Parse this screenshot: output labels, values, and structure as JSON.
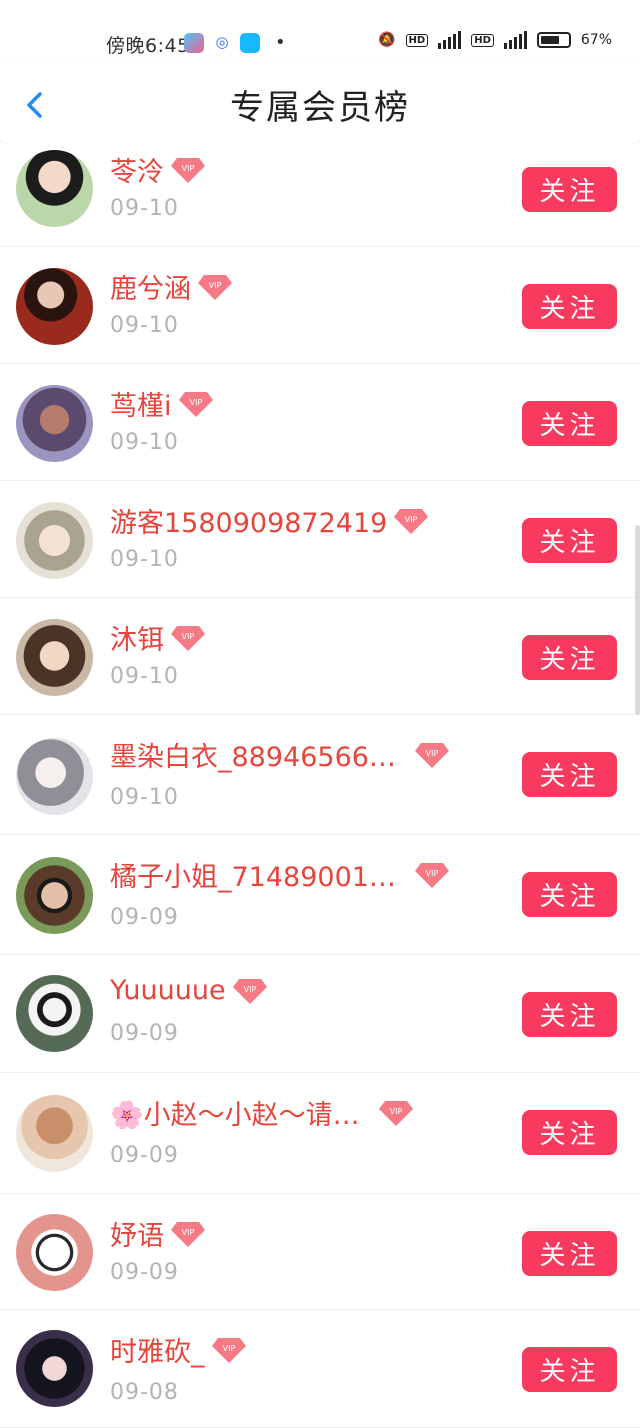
{
  "status": {
    "time": "傍晚6:45",
    "battery": "67%"
  },
  "header": {
    "title": "专属会员榜"
  },
  "rows": [
    {
      "name": "苓泠",
      "date": "09-10",
      "avatar": "#dfe3d6"
    },
    {
      "name": "鹿兮涵",
      "date": "09-10",
      "avatar": "#7a2a22"
    },
    {
      "name": "茑槿i",
      "date": "09-10",
      "avatar": "#8a7fa8"
    },
    {
      "name": "游客1580909872419",
      "date": "09-10",
      "avatar": "#d8d1c4"
    },
    {
      "name": "沐铒",
      "date": "09-10",
      "avatar": "#6b5546"
    },
    {
      "name": "墨染白衣_88946566…",
      "date": "09-10",
      "avatar": "#c9c9cf"
    },
    {
      "name": "橘子小姐_71489001…",
      "date": "09-09",
      "avatar": "#4d6b3a"
    },
    {
      "name": "Yuuuuue",
      "date": "09-09",
      "avatar": "#5a6a5a"
    },
    {
      "name": "🌸小赵～小赵～请…",
      "date": "09-09",
      "avatar": "#d8b49a"
    },
    {
      "name": "妤语",
      "date": "09-09",
      "avatar": "#e59b93"
    },
    {
      "name": "时雅砍_",
      "date": "09-08",
      "avatar": "#1f1f2a"
    }
  ],
  "follow_label": "关注",
  "vip_label": "VIP"
}
